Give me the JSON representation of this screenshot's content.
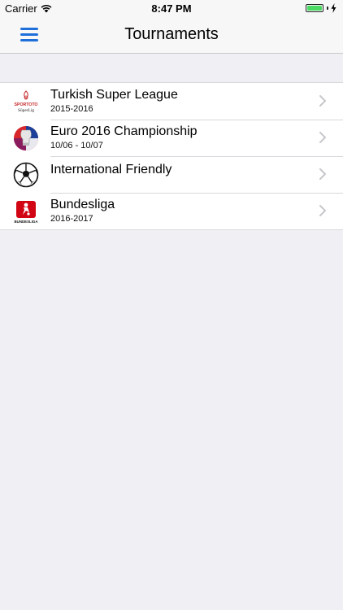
{
  "status_bar": {
    "carrier": "Carrier",
    "time": "8:47 PM",
    "battery_level": 1.0
  },
  "nav": {
    "title": "Tournaments"
  },
  "tournaments": [
    {
      "name": "Turkish Super League",
      "dates": "2015-2016",
      "logo_icon": "spor-toto-super-lig-logo",
      "logo_text_top": "SPORTOTO",
      "logo_text_bottom": "SüperLig"
    },
    {
      "name": "Euro 2016 Championship",
      "dates": "10/06 - 10/07",
      "logo_icon": "euro-2016-logo"
    },
    {
      "name": "International Friendly",
      "dates": "",
      "logo_icon": "soccer-ball-icon"
    },
    {
      "name": "Bundesliga",
      "dates": "2016-2017",
      "logo_icon": "bundesliga-logo",
      "logo_text": "BUNDESLIGA"
    }
  ],
  "colors": {
    "accent": "#1e6fd9",
    "background": "#efeff4",
    "battery": "#4cd964",
    "chevron": "#c7c7cc"
  }
}
